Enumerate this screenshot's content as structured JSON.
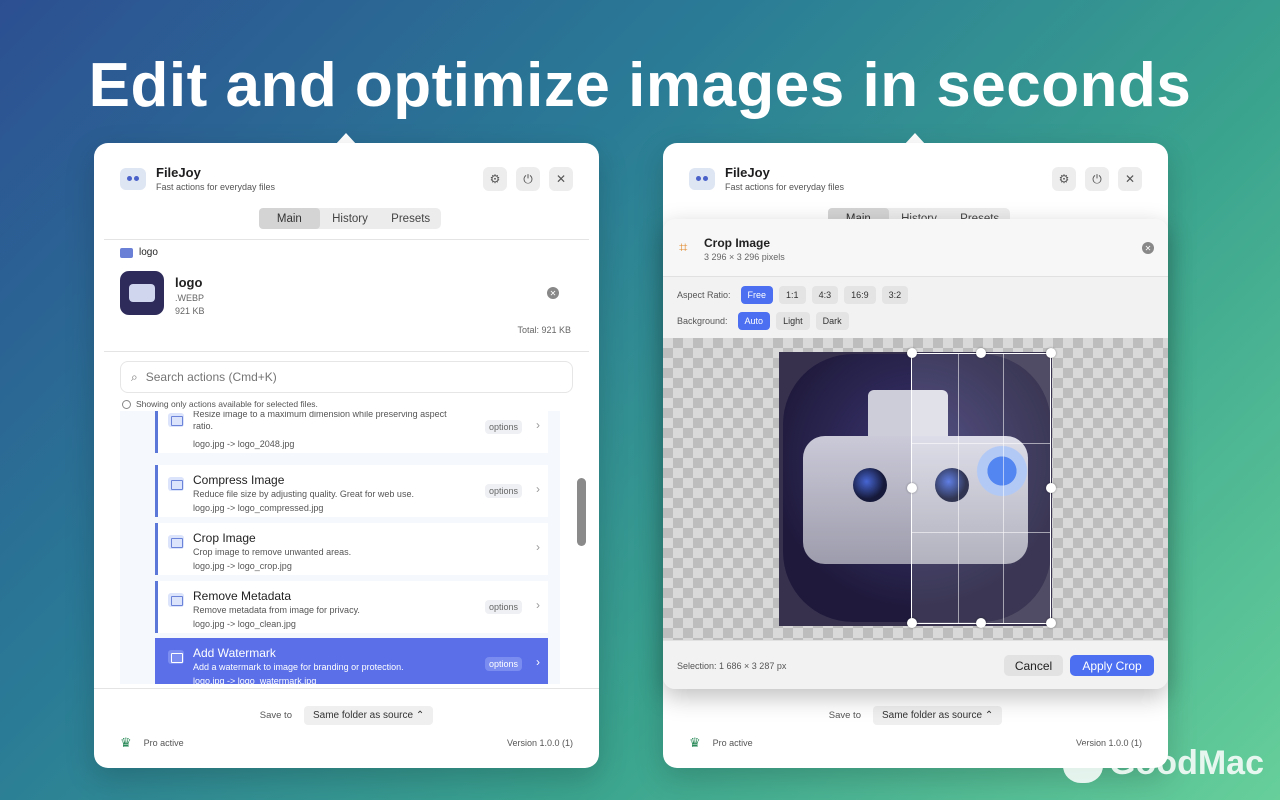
{
  "headline": "Edit and optimize images in seconds",
  "app": {
    "name": "FileJoy",
    "subtitle": "Fast actions for everyday files"
  },
  "window_buttons": [
    "gear-icon",
    "power-icon",
    "close-icon"
  ],
  "tabs": [
    "Main",
    "History",
    "Presets"
  ],
  "file": {
    "group_label": "logo",
    "name": "logo",
    "ext": ".WEBP",
    "size": "921 KB",
    "total": "Total: 921 KB"
  },
  "search": {
    "placeholder": "Search actions (Cmd+K)",
    "hint": "Showing only actions available for selected files."
  },
  "actions": [
    {
      "title": "",
      "desc": "Resize image to a maximum dimension while preserving aspect ratio.",
      "file": "logo.jpg -> logo_2048.jpg",
      "options": "options"
    },
    {
      "title": "Compress Image",
      "desc": "Reduce file size by adjusting quality. Great for web use.",
      "file": "logo.jpg -> logo_compressed.jpg",
      "options": "options"
    },
    {
      "title": "Crop Image",
      "desc": "Crop image to remove unwanted areas.",
      "file": "logo.jpg -> logo_crop.jpg",
      "options": ""
    },
    {
      "title": "Remove Metadata",
      "desc": "Remove metadata from image for privacy.",
      "file": "logo.jpg -> logo_clean.jpg",
      "options": "options"
    },
    {
      "title": "Add Watermark",
      "desc": "Add a watermark to image for branding or protection.",
      "file": "logo.jpg -> logo_watermark.jpg",
      "options": "options"
    }
  ],
  "footer": {
    "save_label": "Save to",
    "save_value": "Same folder as source",
    "pro": "Pro active",
    "version": "Version 1.0.0 (1)"
  },
  "crop": {
    "title": "Crop Image",
    "dimensions": "3 296 × 3 296 pixels",
    "aspect_label": "Aspect Ratio:",
    "aspect_options": [
      "Free",
      "1:1",
      "4:3",
      "16:9",
      "3:2"
    ],
    "aspect_selected": "Free",
    "background_label": "Background:",
    "background_options": [
      "Auto",
      "Light",
      "Dark"
    ],
    "background_selected": "Auto",
    "selection": "Selection: 1 686 × 3 287 px",
    "cancel": "Cancel",
    "apply": "Apply Crop"
  },
  "watermark_text": "GoodMac",
  "colors": {
    "accent": "#4b6ff0",
    "selected_item": "#5a6fe8",
    "crown": "#2c8b5a"
  }
}
